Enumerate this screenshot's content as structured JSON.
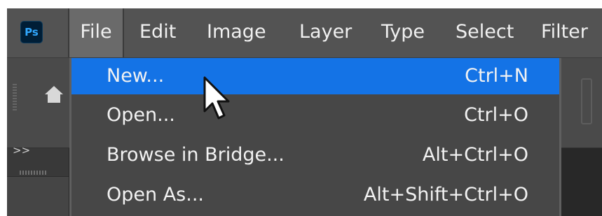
{
  "app": {
    "logo_text": "Ps"
  },
  "menubar": {
    "items": [
      {
        "label": "File",
        "active": true
      },
      {
        "label": "Edit"
      },
      {
        "label": "Image"
      },
      {
        "label": "Layer"
      },
      {
        "label": "Type"
      },
      {
        "label": "Select"
      },
      {
        "label": "Filter"
      }
    ]
  },
  "panel": {
    "expand_label": ">>"
  },
  "file_menu": {
    "items": [
      {
        "label": "New...",
        "shortcut": "Ctrl+N",
        "highlighted": true
      },
      {
        "label": "Open...",
        "shortcut": "Ctrl+O"
      },
      {
        "label": "Browse in Bridge...",
        "shortcut": "Alt+Ctrl+O"
      },
      {
        "label": "Open As...",
        "shortcut": "Alt+Shift+Ctrl+O"
      }
    ]
  },
  "colors": {
    "menubar_bg": "#535353",
    "menu_bg": "#474747",
    "highlight": "#1473e6",
    "ps_blue": "#31a8ff"
  }
}
